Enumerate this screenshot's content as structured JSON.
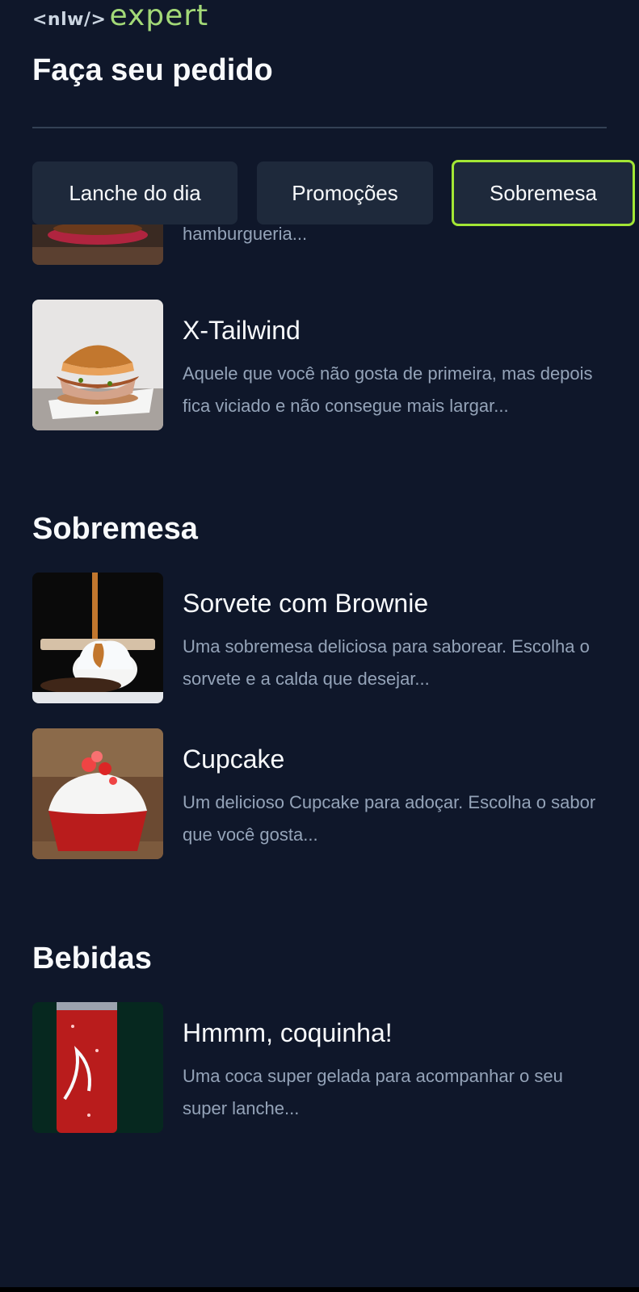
{
  "header": {
    "logo_code": "<nlw/>",
    "logo_word": "expert",
    "title": "Faça seu pedido"
  },
  "tabs": [
    {
      "label": "Lanche do dia",
      "active": false
    },
    {
      "label": "Promoções",
      "active": false
    },
    {
      "label": "Sobremesa",
      "active": true
    }
  ],
  "partial_item": {
    "desc_visible": "cardápio devido aos clientes mais antigos da hamburgueria..."
  },
  "items_top": [
    {
      "title": "X-Tailwind",
      "desc": "Aquele que você não gosta de primeira, mas depois fica viciado e não consegue mais largar..."
    }
  ],
  "sections": [
    {
      "title": "Sobremesa",
      "items": [
        {
          "title": "Sorvete com Brownie",
          "desc": "Uma sobremesa deliciosa para saborear. Escolha o sorvete e a calda que desejar..."
        },
        {
          "title": "Cupcake",
          "desc": "Um delicioso Cupcake para adoçar. Escolha o sabor que você gosta..."
        }
      ]
    },
    {
      "title": "Bebidas",
      "items": [
        {
          "title": "Hmmm, coquinha!",
          "desc": "Uma coca super gelada para acompanhar o seu super lanche..."
        }
      ]
    }
  ],
  "colors": {
    "background": "#0f172a",
    "card": "#1e293b",
    "accent": "#a3e635",
    "muted_text": "#94a3b8"
  }
}
